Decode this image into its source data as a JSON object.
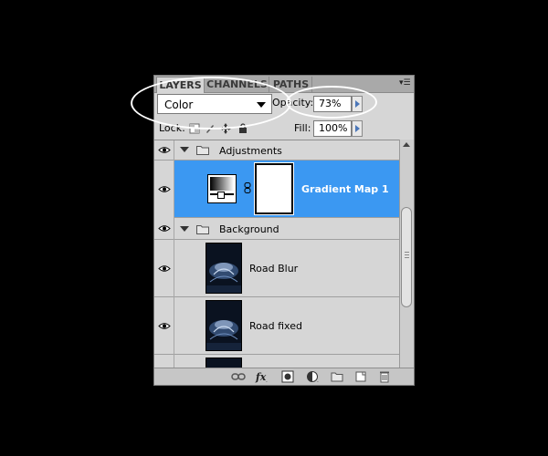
{
  "panel": {
    "tabs": [
      "LAYERS",
      "CHANNELS",
      "PATHS"
    ],
    "active_tab": "LAYERS",
    "menu_icon": "panel-menu-icon"
  },
  "controls": {
    "blend_mode": "Color",
    "opacity_label": "Opacity:",
    "opacity_value": "73%",
    "lock_label": "Lock:",
    "fill_label": "Fill:",
    "fill_value": "100%"
  },
  "layers": [
    {
      "type": "group",
      "name": "Adjustments",
      "visible": true,
      "expanded": true
    },
    {
      "type": "adjustment",
      "name": "Gradient Map 1",
      "visible": true,
      "selected": true
    },
    {
      "type": "group",
      "name": "Background",
      "visible": true,
      "expanded": true
    },
    {
      "type": "image",
      "name": "Road Blur",
      "visible": true
    },
    {
      "type": "image",
      "name": "Road fixed",
      "visible": true
    }
  ],
  "bottom_icons": [
    "link-layers-icon",
    "fx-icon",
    "add-mask-icon",
    "new-adjustment-icon",
    "new-group-icon",
    "new-layer-icon",
    "delete-layer-icon"
  ],
  "colors": {
    "selection": "#3b98f2",
    "panel_bg": "#d6d6d6",
    "background": "#000000",
    "callout": "#ffffff"
  }
}
